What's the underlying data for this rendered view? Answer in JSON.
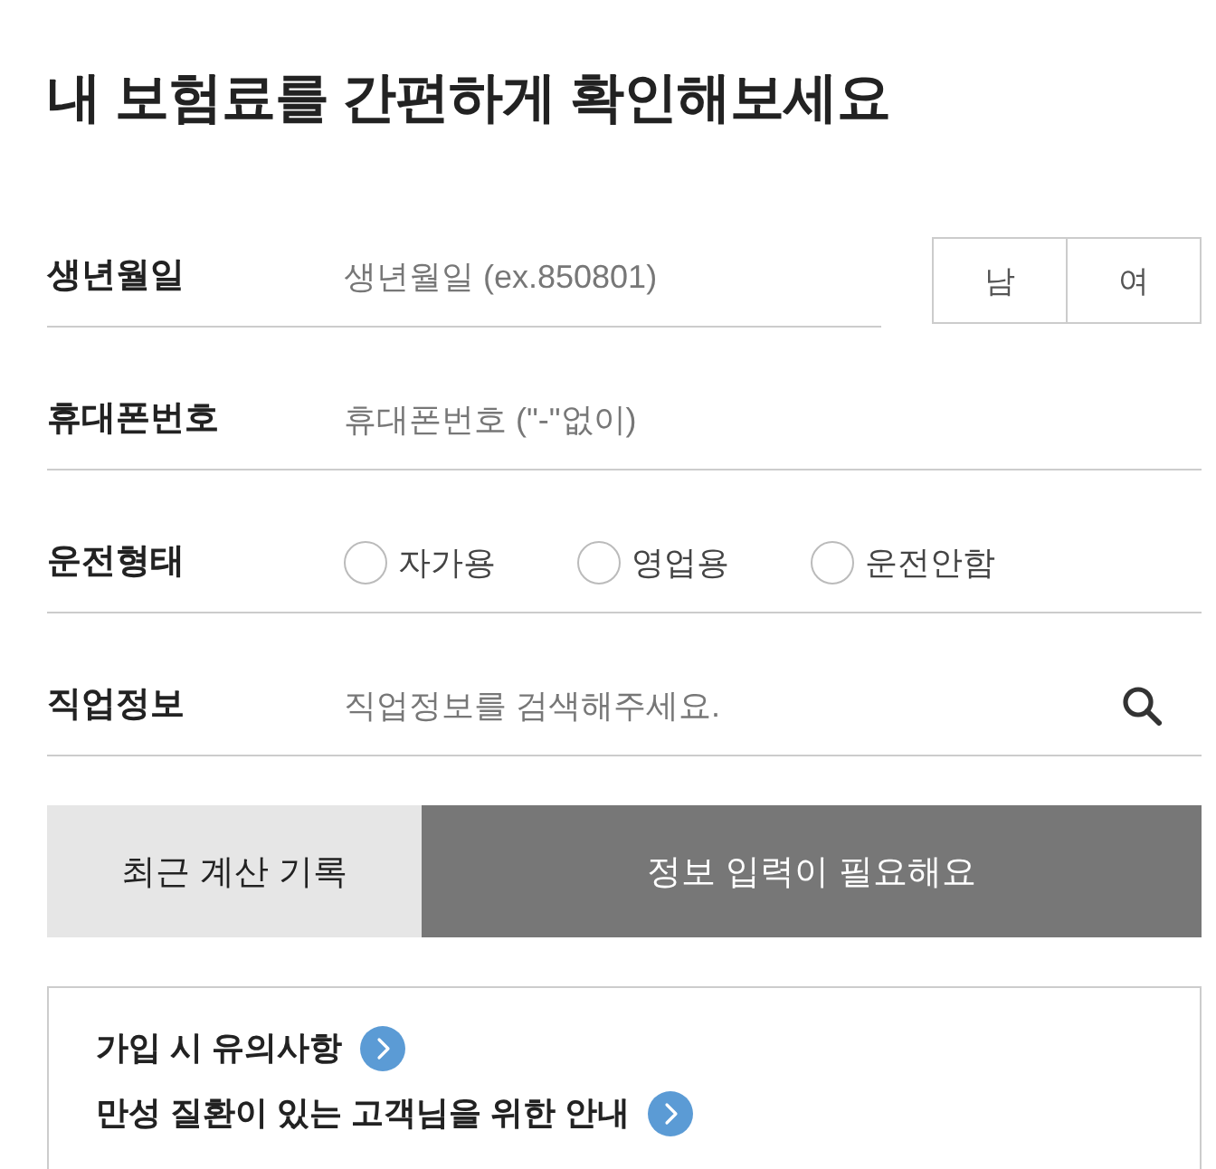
{
  "title": "내 보험료를 간편하게 확인해보세요",
  "rows": [
    {
      "kind": "input",
      "label": "생년월일",
      "placeholder": "생년월일 (ex.850801)",
      "toggles": [
        {
          "label": "남",
          "selected": false
        },
        {
          "label": "여",
          "selected": false
        }
      ]
    },
    {
      "kind": "input",
      "label": "휴대폰번호",
      "placeholder": "휴대폰번호 (\"-\"없이)"
    },
    {
      "kind": "radio",
      "label": "운전형태",
      "options": [
        {
          "label": "자가용",
          "selected": false
        },
        {
          "label": "영업용",
          "selected": false
        },
        {
          "label": "운전안함",
          "selected": false
        }
      ]
    },
    {
      "kind": "search",
      "label": "직업정보",
      "placeholder": "직업정보를 검색해주세요."
    }
  ],
  "actions": [
    {
      "kind": "secondary",
      "label": "최근 계산 기록"
    },
    {
      "kind": "primary",
      "label": "정보 입력이 필요해요"
    }
  ],
  "notices": [
    {
      "label": "가입 시 유의사항"
    },
    {
      "label": "만성 질환이 있는 고객님을 위한 안내"
    }
  ]
}
